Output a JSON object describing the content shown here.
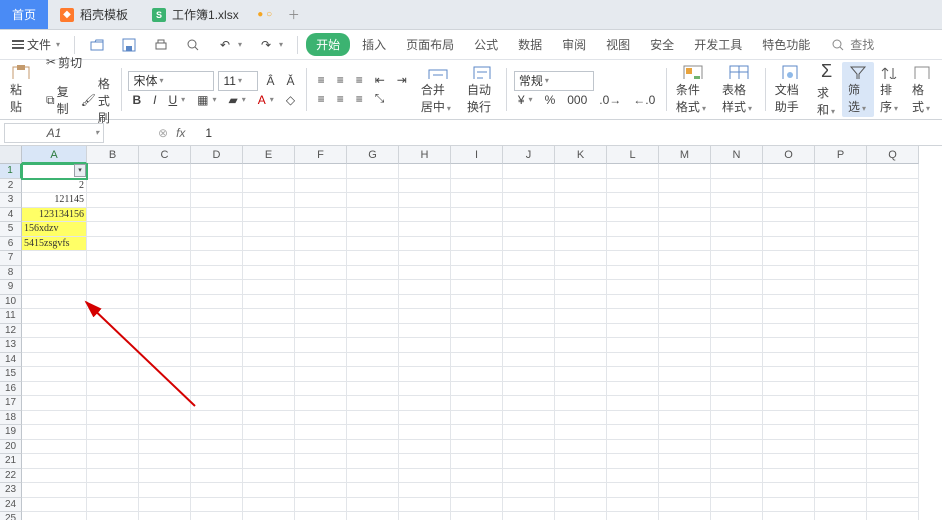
{
  "tabs": {
    "home": "首页",
    "daoke": "稻壳模板",
    "workbook": "工作簿1.xlsx"
  },
  "menu": {
    "file": "文件",
    "ribbon": [
      "开始",
      "插入",
      "页面布局",
      "公式",
      "数据",
      "审阅",
      "视图",
      "安全",
      "开发工具",
      "特色功能"
    ],
    "search": "查找"
  },
  "toolbar": {
    "paste": "粘贴",
    "cut": "剪切",
    "copy": "复制",
    "format_painter": "格式刷",
    "font_name": "宋体",
    "font_size": "11",
    "merge": "合并居中",
    "wrap": "自动换行",
    "numfmt": "常规",
    "cond_fmt": "条件格式",
    "table_style": "表格样式",
    "doc_assist": "文档助手",
    "sum": "求和",
    "filter": "筛选",
    "sort": "排序",
    "format": "格式"
  },
  "formula_bar": {
    "name": "A1",
    "fx": "fx",
    "value": "1"
  },
  "grid": {
    "cols": [
      "A",
      "B",
      "C",
      "D",
      "E",
      "F",
      "G",
      "H",
      "I",
      "J",
      "K",
      "L",
      "M",
      "N",
      "O",
      "P",
      "Q"
    ],
    "rows": 25,
    "data": {
      "A1": {
        "v": "",
        "sel": true,
        "dd": true
      },
      "A2": {
        "v": "2",
        "align": "r"
      },
      "A3": {
        "v": "121145",
        "align": "r"
      },
      "A4": {
        "v": "123134156",
        "align": "r",
        "hl": true
      },
      "A5": {
        "v": "156xdzv",
        "align": "l",
        "hl": true
      },
      "A6": {
        "v": "5415zsgvfs",
        "align": "l",
        "hl": true
      }
    }
  }
}
